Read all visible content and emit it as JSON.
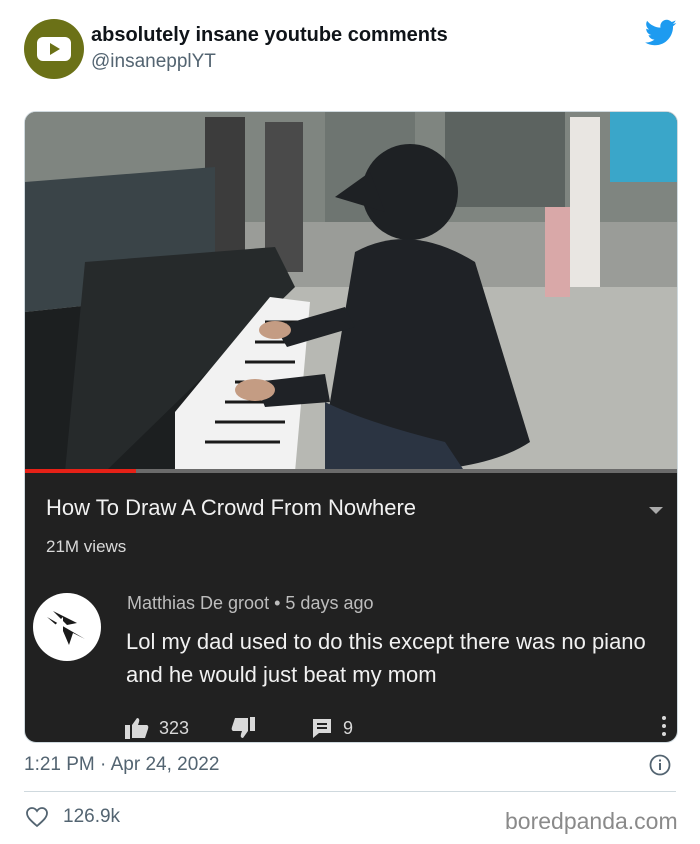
{
  "tweet": {
    "display_name": "absolutely insane youtube comments",
    "handle": "@insanepplYT",
    "timestamp": "1:21 PM · Apr 24, 2022",
    "like_count": "126.9k",
    "brand_color": "#1d9bf0",
    "avatar_color": "#6b7117",
    "icons": {
      "avatar": "youtube-play-logo",
      "platform": "twitter-bird-icon",
      "info": "info-icon",
      "like": "heart-icon"
    }
  },
  "youtube": {
    "video_title": "How To Draw A Crowd From Nowhere",
    "views": "21M views",
    "progress_fraction": 0.17,
    "comment": {
      "author": "Matthias De groot",
      "separator": "•",
      "age": "5 days ago",
      "text": "Lol my dad used to do this except there was no piano and he would just beat my mom",
      "likes": "323",
      "replies": "9"
    }
  },
  "watermark": "boredpanda.com"
}
